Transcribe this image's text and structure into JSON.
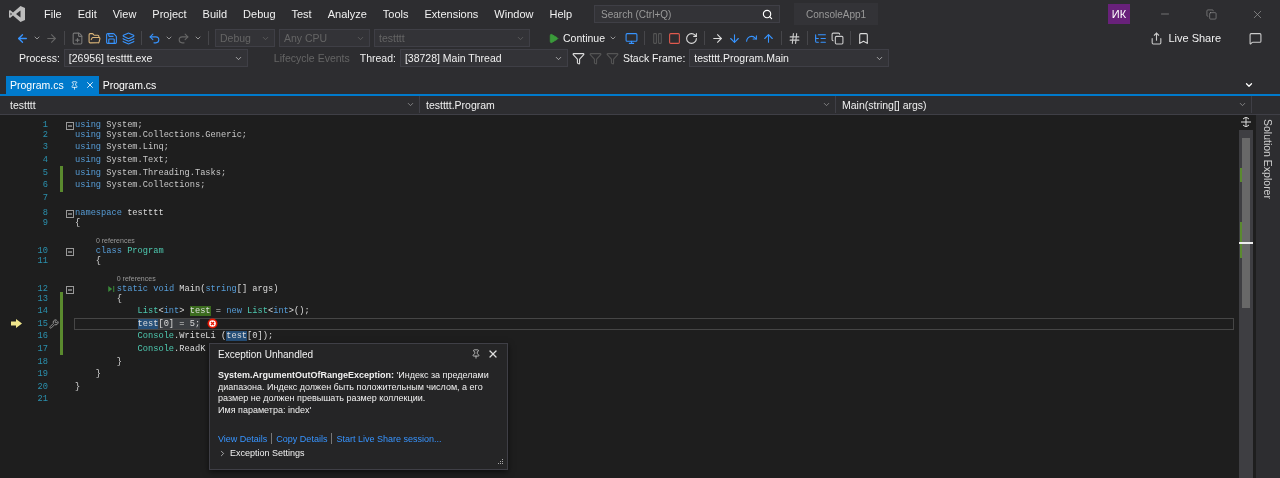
{
  "menu_bar": {
    "items": [
      "File",
      "Edit",
      "View",
      "Project",
      "Build",
      "Debug",
      "Test",
      "Analyze",
      "Tools",
      "Extensions",
      "Window",
      "Help"
    ],
    "search": {
      "placeholder": "Search (Ctrl+Q)"
    },
    "solution_name": "ConsoleApp1",
    "user_initials": "ИК"
  },
  "toolbar": {
    "configuration": {
      "value": "Debug",
      "disabled": true
    },
    "platform": {
      "value": "Any CPU",
      "disabled": true
    },
    "startup_project": {
      "value": "testttt",
      "disabled": true
    },
    "continue_label": "Continue",
    "live_share_label": "Live Share"
  },
  "debug_location": {
    "process_label": "Process:",
    "process": "[26956] testttt.exe",
    "lifecycle_events": {
      "label": "Lifecycle Events",
      "disabled": true
    },
    "thread_label": "Thread:",
    "thread": "[38728] Main Thread",
    "stack_frame_label": "Stack Frame:",
    "stack_frame": "testttt.Program.Main"
  },
  "tabs": [
    {
      "label": "Program.cs",
      "selected": true
    },
    {
      "label": "Program.cs",
      "selected": false
    }
  ],
  "nav_bar": {
    "project": "testttt",
    "type": "testttt.Program",
    "member": "Main(string[] args)"
  },
  "side_tab": "Solution Explorer",
  "editor": {
    "lines": [
      {
        "number": "1",
        "collapsible": true,
        "changed": false,
        "current": false,
        "tokens": [
          {
            "kind": "keyword",
            "text": "using"
          },
          {
            "kind": "namespace",
            "text": " System;"
          }
        ]
      },
      {
        "number": "2",
        "collapsible": false,
        "changed": false,
        "current": false,
        "tokens": [
          {
            "kind": "keyword",
            "text": "using"
          },
          {
            "kind": "namespace",
            "text": " System.Collections.Generic;"
          }
        ]
      },
      {
        "number": "3",
        "collapsible": false,
        "changed": false,
        "current": false,
        "tokens": [
          {
            "kind": "keyword",
            "text": "using"
          },
          {
            "kind": "namespace",
            "text": " System.Linq;"
          }
        ]
      },
      {
        "number": "4",
        "collapsible": false,
        "changed": false,
        "current": false,
        "tokens": [
          {
            "kind": "keyword",
            "text": "using"
          },
          {
            "kind": "namespace",
            "text": " System.Text;"
          }
        ]
      },
      {
        "number": "5",
        "collapsible": false,
        "changed": true,
        "current": false,
        "tokens": [
          {
            "kind": "keyword",
            "text": "using"
          },
          {
            "kind": "namespace",
            "text": " System.Threading.Tasks;"
          }
        ]
      },
      {
        "number": "6",
        "collapsible": false,
        "changed": true,
        "current": false,
        "tokens": [
          {
            "kind": "keyword",
            "text": "using"
          },
          {
            "kind": "namespace",
            "text": " System.Collections;"
          }
        ]
      },
      {
        "number": "7",
        "collapsible": false,
        "changed": false,
        "current": false
      },
      {
        "number": "8",
        "collapsible": true,
        "changed": false,
        "current": false,
        "tokens": [
          {
            "kind": "keyword",
            "text": "namespace"
          },
          {
            "kind": "plain",
            "text": " testttt"
          }
        ]
      },
      {
        "number": "9",
        "collapsible": false,
        "changed": false,
        "current": false,
        "tokens": [
          {
            "kind": "plain",
            "text": "{"
          }
        ]
      },
      {
        "number": "10",
        "collapsible": true,
        "changed": false,
        "current": false,
        "codelens": "0 references",
        "tokens": [
          {
            "kind": "keyword",
            "text": "    class"
          },
          {
            "kind": "type",
            "text": " Program"
          }
        ]
      },
      {
        "number": "11",
        "collapsible": false,
        "changed": false,
        "current": false,
        "tokens": [
          {
            "kind": "plain",
            "text": "    {"
          }
        ]
      },
      {
        "number": "12",
        "collapsible": true,
        "changed": false,
        "current": false,
        "codelens": "0 references",
        "tokens": [
          {
            "kind": "run"
          },
          {
            "kind": "keyword",
            "text": "static"
          },
          {
            "kind": "keyword",
            "text": " void"
          },
          {
            "kind": "plain",
            "text": " Main("
          },
          {
            "kind": "keyword",
            "text": "string"
          },
          {
            "kind": "plain",
            "text": "[] args)"
          }
        ]
      },
      {
        "number": "13",
        "collapsible": false,
        "changed": true,
        "current": false,
        "tokens": [
          {
            "kind": "plain",
            "text": "        {"
          }
        ]
      },
      {
        "number": "14",
        "collapsible": false,
        "changed": true,
        "current": false,
        "tokens": [
          {
            "kind": "type",
            "text": "            List"
          },
          {
            "kind": "plain",
            "text": "<"
          },
          {
            "kind": "keyword",
            "text": "int"
          },
          {
            "kind": "plain",
            "text": "> "
          },
          {
            "kind": "write-ref",
            "text": "test"
          },
          {
            "kind": "plain",
            "text": " = "
          },
          {
            "kind": "keyword",
            "text": "new"
          },
          {
            "kind": "type",
            "text": " List"
          },
          {
            "kind": "plain",
            "text": "<"
          },
          {
            "kind": "keyword",
            "text": "int"
          },
          {
            "kind": "plain",
            "text": ">();"
          }
        ]
      },
      {
        "number": "15",
        "collapsible": false,
        "changed": true,
        "current": true,
        "tokens": [
          {
            "kind": "read-ref",
            "text": "            test"
          },
          {
            "kind": "statement",
            "text": "[0] = 5;"
          }
        ]
      },
      {
        "number": "16",
        "collapsible": false,
        "changed": true,
        "current": false,
        "tokens": [
          {
            "kind": "type",
            "text": "            Console"
          },
          {
            "kind": "plain",
            "text": ".WriteLi"
          },
          {
            "kind": "plain",
            "text": " ("
          },
          {
            "kind": "read-ref",
            "text": "test"
          },
          {
            "kind": "plain",
            "text": "[0]);"
          }
        ]
      },
      {
        "number": "17",
        "collapsible": false,
        "changed": true,
        "current": false,
        "tokens": [
          {
            "kind": "type",
            "text": "            Console"
          },
          {
            "kind": "plain",
            "text": ".ReadK"
          }
        ]
      },
      {
        "number": "18",
        "collapsible": false,
        "changed": false,
        "current": false,
        "tokens": [
          {
            "kind": "plain",
            "text": "        }"
          }
        ]
      },
      {
        "number": "19",
        "collapsible": false,
        "changed": false,
        "current": false,
        "tokens": [
          {
            "kind": "plain",
            "text": "    }"
          }
        ]
      },
      {
        "number": "20",
        "collapsible": false,
        "changed": false,
        "current": false,
        "tokens": [
          {
            "kind": "plain",
            "text": "}"
          }
        ]
      },
      {
        "number": "21",
        "collapsible": false,
        "changed": false,
        "current": false
      }
    ]
  },
  "exception_popup": {
    "title": "Exception Unhandled",
    "message": "**System.ArgumentOutOfRangeException:** 'Индекс за пределами диапазона. Индекс должен быть положительным числом, а его размер не должен превышать размер коллекции.",
    "parameter_line": "Имя параметра: index'",
    "links": [
      "View Details",
      "Copy Details",
      "Start Live Share session..."
    ],
    "settings_label": "Exception Settings",
    "settings_expanded": false
  }
}
